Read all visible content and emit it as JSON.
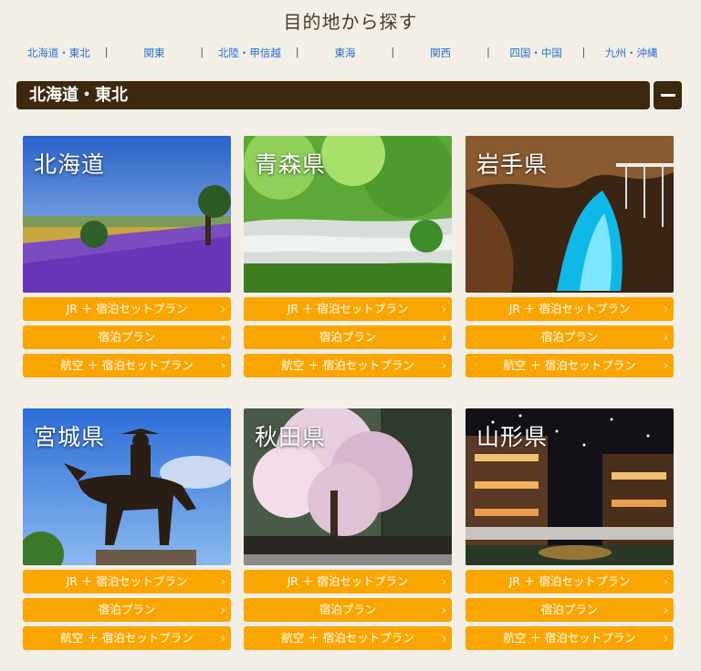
{
  "page": {
    "title": "目的地から探す"
  },
  "regions": [
    "北海道・東北",
    "関東",
    "北陸・甲信越",
    "東海",
    "関西",
    "四国・中国",
    "九州・沖縄"
  ],
  "section": {
    "title": "北海道・東北"
  },
  "plans": {
    "jr": "JR ＋ 宿泊セットプラン",
    "stay": "宿泊プラン",
    "air": "航空 ＋ 宿泊セットプラン"
  },
  "prefectures": [
    {
      "name": "北海道"
    },
    {
      "name": "青森県"
    },
    {
      "name": "岩手県"
    },
    {
      "name": "宮城県"
    },
    {
      "name": "秋田県"
    },
    {
      "name": "山形県"
    }
  ]
}
